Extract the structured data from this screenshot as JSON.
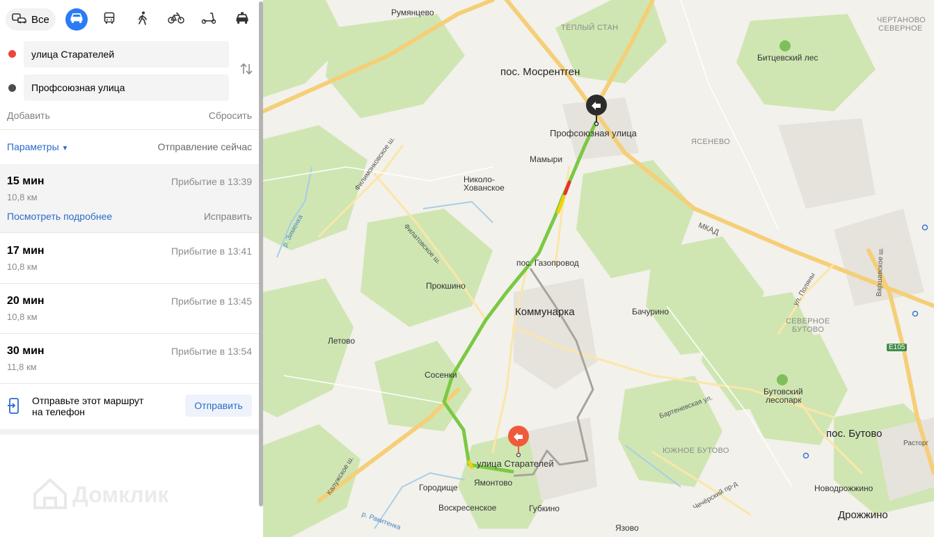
{
  "modes": {
    "all_label": "Все"
  },
  "route_form": {
    "from": "улица Старателей",
    "to": "Профсоюзная улица",
    "add_label": "Добавить",
    "reset_label": "Сбросить"
  },
  "options": {
    "params_label": "Параметры",
    "departure_label": "Отправление сейчас"
  },
  "routes": [
    {
      "time": "15 мин",
      "distance": "10,8 км",
      "arrival": "Прибытие в 13:39",
      "details_label": "Посмотреть подробнее",
      "fix_label": "Исправить"
    },
    {
      "time": "17 мин",
      "distance": "10,8 км",
      "arrival": "Прибытие в 13:41"
    },
    {
      "time": "20 мин",
      "distance": "10,8 км",
      "arrival": "Прибытие в 13:45"
    },
    {
      "time": "30 мин",
      "distance": "11,8 км",
      "arrival": "Прибытие в 13:54"
    }
  ],
  "send": {
    "text_line1": "Отправьте этот маршрут",
    "text_line2": "на телефон",
    "button_label": "Отправить"
  },
  "watermark": "Домклик",
  "map": {
    "labels": {
      "rumyantsevo": "Румянцево",
      "teply_stan": "ТЁПЛЫЙ СТАН",
      "chertanovo1": "ЧЕРТАНОВО",
      "chertanovo2": "СЕВЕРНОЕ",
      "bitsa": "Битцевский лес",
      "mosrentgen": "пос. Мосрентген",
      "profsoyuznaya": "Профсоюзная улица",
      "yasenevo": "ЯСЕНЕВО",
      "mamyri": "Мамыри",
      "nikolo1": "Николо-",
      "nikolo2": "Хованское",
      "filimonk": "Филимонковское ш.",
      "zimenka": "р. Зименка",
      "filatovskoe": "Филатовское ш.",
      "mkad": "МКАД",
      "gazoprovod": "пос. Газопровод",
      "prokshino": "Прокшино",
      "kommunarka": "Коммунарка",
      "bachurino": "Бачурино",
      "ul_polyany": "ул. Поляны",
      "varshavskoe": "Варшавское ш.",
      "sev_butovo1": "СЕВЕРНОЕ",
      "sev_butovo2": "БУТОВО",
      "letovo": "Летово",
      "e105": "E105",
      "sosenki": "Сосенки",
      "butovsky1": "Бутовский",
      "butovsky2": "лесопарк",
      "bartenevskaya": "Бартеневская ул.",
      "yuzh_butovo": "ЮЖНОЕ БУТОВО",
      "pos_butovo": "пос. Бутово",
      "kaluzhskoe": "Калужское ш.",
      "starateley": "улица Старателей",
      "gorodishche": "Городище",
      "yamontovo": "Ямонтово",
      "chechersky": "Чечёрский пр-д",
      "novodrozhzhino": "Новодрожжино",
      "rakitenka": "р. Ракитенка",
      "voskresenskoe": "Воскресенское",
      "gubkino": "Губкино",
      "yazovo": "Язово",
      "drozhzhino": "Дрожжино",
      "rastorg": "Расторг"
    }
  },
  "colors": {
    "accent": "#2a7cf6",
    "link": "#2a6bc9",
    "from_dot": "#f0433a",
    "to_dot": "#4d4d4d",
    "route_green": "#7ac943",
    "route_yellow": "#f2d10d",
    "route_red": "#e8342a",
    "route_alt": "#a8a49d",
    "marker_start": "#f05a3c",
    "marker_end": "#2b2b2b"
  }
}
